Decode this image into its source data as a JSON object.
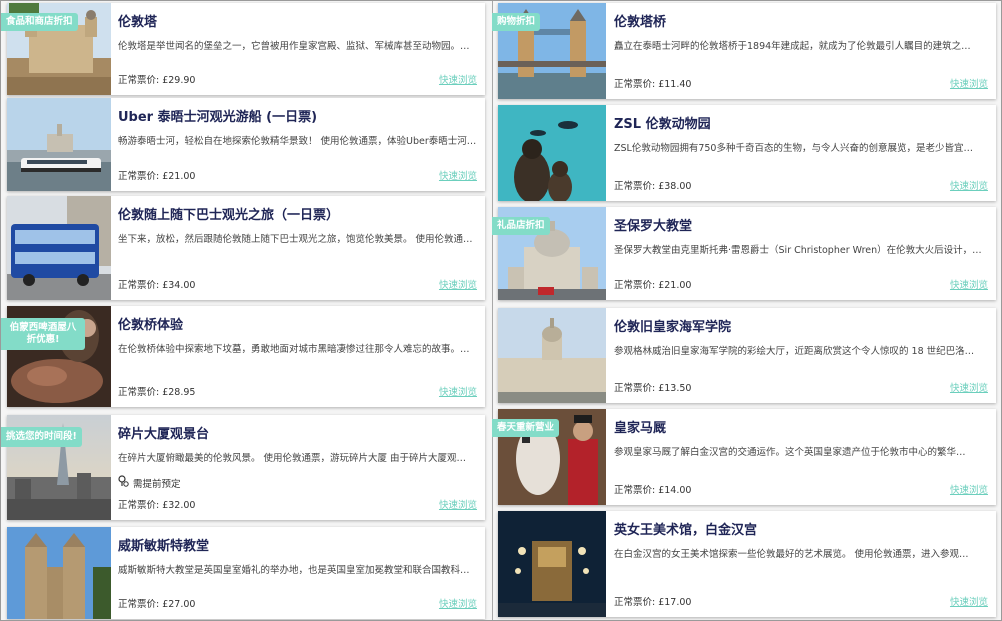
{
  "left": [
    {
      "title": "伦敦塔",
      "desc": "伦敦塔是举世闻名的堡垒之一，它曾被用作皇家宫殿、监狱、军械库甚至动物园。…",
      "price": "正常票价: £29.90",
      "quick": "快速浏览",
      "badge": "食品和商店折扣"
    },
    {
      "title": "Uber 泰晤士河观光游船 (一日票)",
      "desc": "畅游泰晤士河，轻松自在地探索伦敦精华景致！ 使用伦敦通票，体验Uber泰晤士河…",
      "price": "正常票价: £21.00",
      "quick": "快速浏览"
    },
    {
      "title": "伦敦随上随下巴士观光之旅（一日票）",
      "desc": "坐下来，放松，然后跟随伦敦随上随下巴士观光之旅，饱览伦敦美景。 使用伦敦通…",
      "price": "正常票价: £34.00",
      "quick": "快速浏览"
    },
    {
      "title": "伦敦桥体验",
      "desc": "在伦敦桥体验中探索地下坟墓，勇敢地面对城市黑暗凄惨过往那令人难忘的故事。…",
      "price": "正常票价: £28.95",
      "quick": "快速浏览",
      "badge": "伯蒙西啤酒屋八折优惠!"
    },
    {
      "title": "碎片大厦观景台",
      "desc": "在碎片大厦俯瞰最美的伦敦风景。 使用伦敦通票，游玩碎片大厦 由于碎片大厦观…",
      "extra": "需提前预定",
      "price": "正常票价: £32.00",
      "quick": "快速浏览",
      "badge": "挑选您的时间段!"
    },
    {
      "title": "威斯敏斯特教堂",
      "desc": "威斯敏斯特大教堂是英国皇室婚礼的举办地，也是英国皇室加冕教堂和联合国教科…",
      "price": "正常票价: £27.00",
      "quick": "快速浏览"
    }
  ],
  "right": [
    {
      "title": "伦敦塔桥",
      "desc": "矗立在泰晤士河畔的伦敦塔桥于1894年建成起，就成为了伦敦最引人瞩目的建筑之…",
      "price": "正常票价: £11.40",
      "quick": "快速浏览",
      "badge": "购物折扣"
    },
    {
      "title": "ZSL 伦敦动物园",
      "desc": "ZSL伦敦动物园拥有750多种千奇百态的生物，与令人兴奋的创意展览，是老少皆宜…",
      "price": "正常票价: £38.00",
      "quick": "快速浏览"
    },
    {
      "title": "圣保罗大教堂",
      "desc": "圣保罗大教堂由克里斯托弗·雷恩爵士（Sir Christopher Wren）在伦敦大火后设计，…",
      "price": "正常票价: £21.00",
      "quick": "快速浏览",
      "badge": "礼品店折扣"
    },
    {
      "title": "伦敦旧皇家海军学院",
      "desc": "参观格林威治旧皇家海军学院的彩绘大厅，近距离欣赏这个令人惊叹的 18 世纪巴洛…",
      "price": "正常票价: £13.50",
      "quick": "快速浏览"
    },
    {
      "title": "皇家马厩",
      "desc": "参观皇家马厩了解白金汉宫的交通运作。这个英国皇家遗产位于伦敦市中心的繁华…",
      "price": "正常票价: £14.00",
      "quick": "快速浏览",
      "badge": "春天重新营业"
    },
    {
      "title": "英女王美术馆，白金汉宫",
      "desc": "在白金汉宫的女王美术馆探索一些伦敦最好的艺术展览。 使用伦敦通票，进入参观…",
      "price": "正常票价: £17.00",
      "quick": "快速浏览"
    }
  ]
}
